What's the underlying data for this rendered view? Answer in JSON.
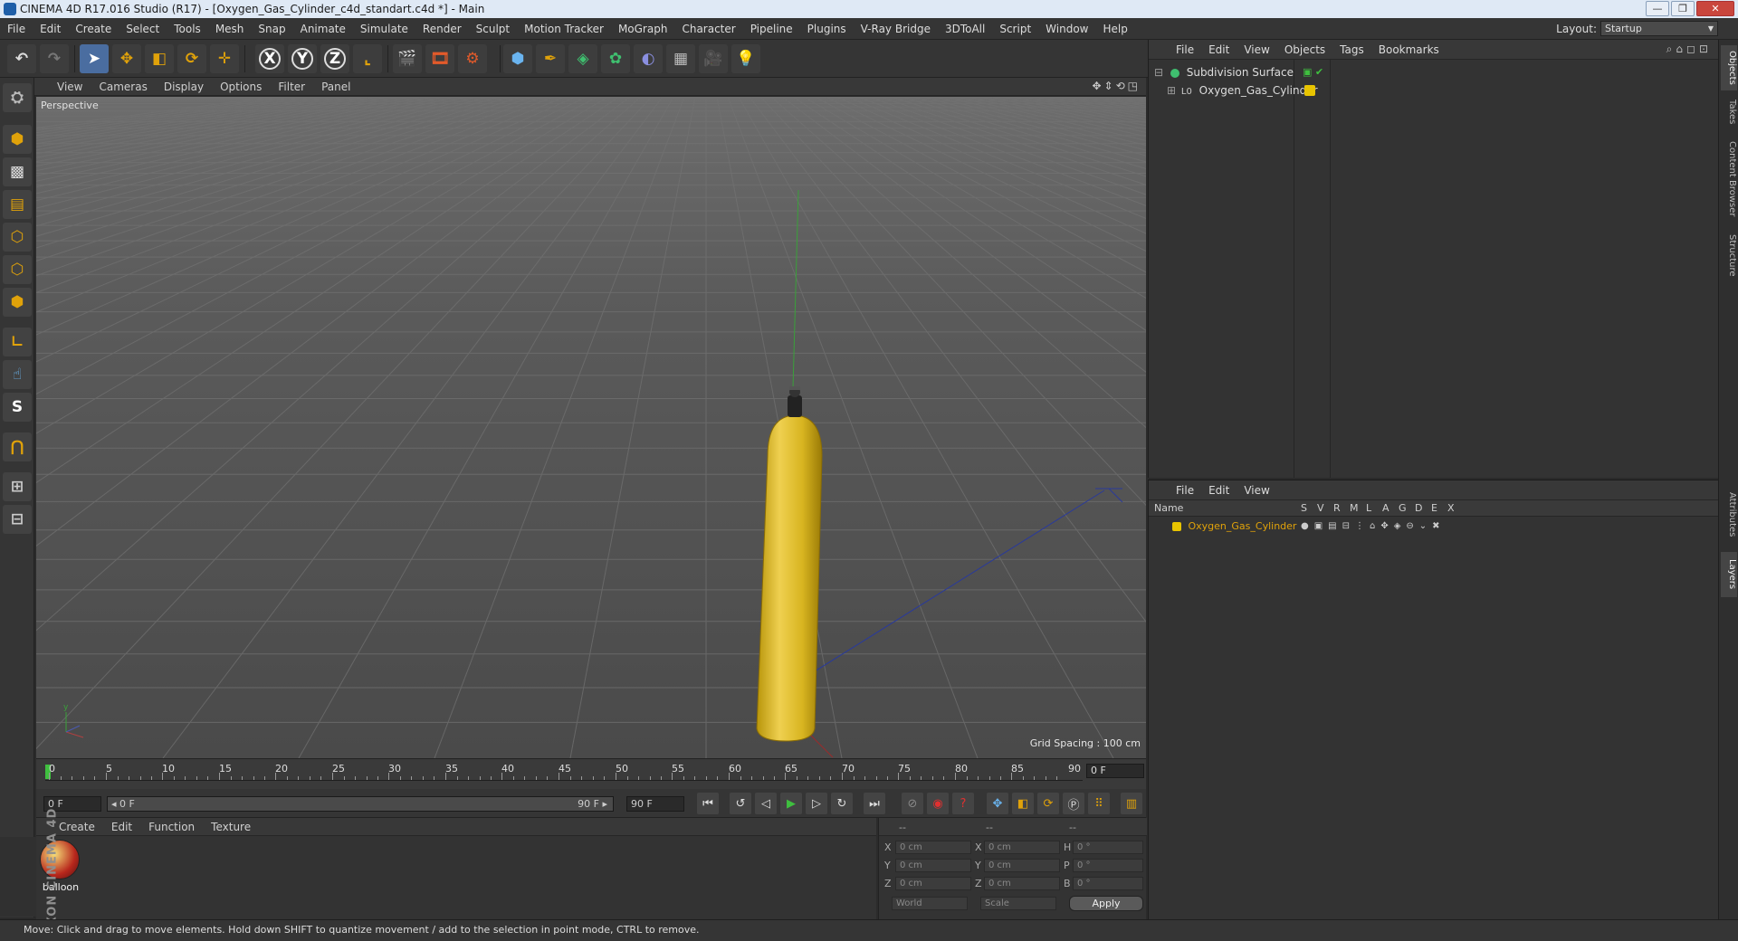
{
  "window": {
    "title": "CINEMA 4D R17.016 Studio (R17) - [Oxygen_Gas_Cylinder_c4d_standart.c4d *] - Main",
    "buttons": [
      "—",
      "❐",
      "✕"
    ]
  },
  "menubar": {
    "items": [
      "File",
      "Edit",
      "Create",
      "Select",
      "Tools",
      "Mesh",
      "Snap",
      "Animate",
      "Simulate",
      "Render",
      "Sculpt",
      "Motion Tracker",
      "MoGraph",
      "Character",
      "Pipeline",
      "Plugins",
      "V-Ray Bridge",
      "3DToAll",
      "Script",
      "Window",
      "Help"
    ],
    "layout_label": "Layout:",
    "layout_value": "Startup"
  },
  "toolbar": {
    "icons": [
      "undo-icon",
      "redo-icon",
      "select-arrow-icon",
      "move-icon",
      "scale-icon",
      "rotate-icon",
      "live-selection-icon",
      "x-axis-lock",
      "y-axis-lock",
      "z-axis-lock",
      "coordinate-system-icon",
      "render-view-icon",
      "render-picture-viewer-icon",
      "render-settings-icon",
      "cube-primitive-icon",
      "pen-spline-icon",
      "subdivision-icon",
      "cloner-icon",
      "deformer-icon",
      "floor-icon",
      "camera-icon",
      "light-icon"
    ],
    "axis_labels": [
      "X",
      "Y",
      "Z"
    ]
  },
  "left_toolbar": {
    "icons": [
      "make-editable-icon",
      "model-mode-icon",
      "texture-mode-icon",
      "workplane-icon",
      "points-mode-icon",
      "edges-mode-icon",
      "polygons-mode-icon",
      "axis-mode-icon",
      "tweak-mode-icon",
      "solo-mode-icon",
      "magnet-icon",
      "snap-icon",
      "quantize-icon"
    ],
    "solo_label": "S"
  },
  "viewport": {
    "menu": [
      "View",
      "Cameras",
      "Display",
      "Options",
      "Filter",
      "Panel"
    ],
    "camera_label": "Perspective",
    "grid_spacing": "Grid Spacing : 100 cm"
  },
  "timeline": {
    "ticks": [
      "0",
      "5",
      "10",
      "15",
      "20",
      "25",
      "30",
      "35",
      "40",
      "45",
      "50",
      "55",
      "60",
      "65",
      "70",
      "75",
      "80",
      "85",
      "90"
    ],
    "current_frame": "0 F"
  },
  "transport": {
    "start_field": "0 F",
    "range_start": "◂ 0 F",
    "range_end": "90 F ▸",
    "end_field": "90 F"
  },
  "material_manager": {
    "menu": [
      "Create",
      "Edit",
      "Function",
      "Texture"
    ],
    "materials": [
      {
        "name": "balloon"
      }
    ]
  },
  "coordinates": {
    "headers": [
      "--",
      "--",
      "--"
    ],
    "rows": [
      {
        "axis": "X",
        "pos": "0 cm",
        "axis2": "X",
        "size": "0 cm",
        "rot_axis": "H",
        "rot": "0 °"
      },
      {
        "axis": "Y",
        "pos": "0 cm",
        "axis2": "Y",
        "size": "0 cm",
        "rot_axis": "P",
        "rot": "0 °"
      },
      {
        "axis": "Z",
        "pos": "0 cm",
        "axis2": "Z",
        "size": "0 cm",
        "rot_axis": "B",
        "rot": "0 °"
      }
    ],
    "mode_select": "World",
    "scale_select": "Scale",
    "apply_label": "Apply"
  },
  "object_manager": {
    "menu": [
      "File",
      "Edit",
      "View",
      "Objects",
      "Tags",
      "Bookmarks"
    ],
    "objects": [
      {
        "name": "Subdivision Surface"
      },
      {
        "name": "Oxygen_Gas_Cylinder"
      }
    ]
  },
  "layer_manager": {
    "menu": [
      "File",
      "Edit",
      "View"
    ],
    "columns": [
      "Name",
      "S",
      "V",
      "R",
      "M",
      "L",
      "A",
      "G",
      "D",
      "E",
      "X"
    ],
    "layers": [
      {
        "name": "Oxygen_Gas_Cylinder",
        "color": "#e8c400"
      }
    ]
  },
  "right_tabs": [
    "Objects",
    "Takes",
    "Content Browser",
    "Structure",
    "Attributes",
    "Layers"
  ],
  "status": {
    "text": "Move: Click and drag to move elements. Hold down SHIFT to quantize movement / add to the selection in point mode, CTRL to remove."
  },
  "branding": {
    "logo_text": "MAXON CINEMA 4D"
  },
  "colors": {
    "accent_orange": "#e0a20a",
    "object_yellow": "#e8c400",
    "active_blue": "#3a88d0"
  }
}
